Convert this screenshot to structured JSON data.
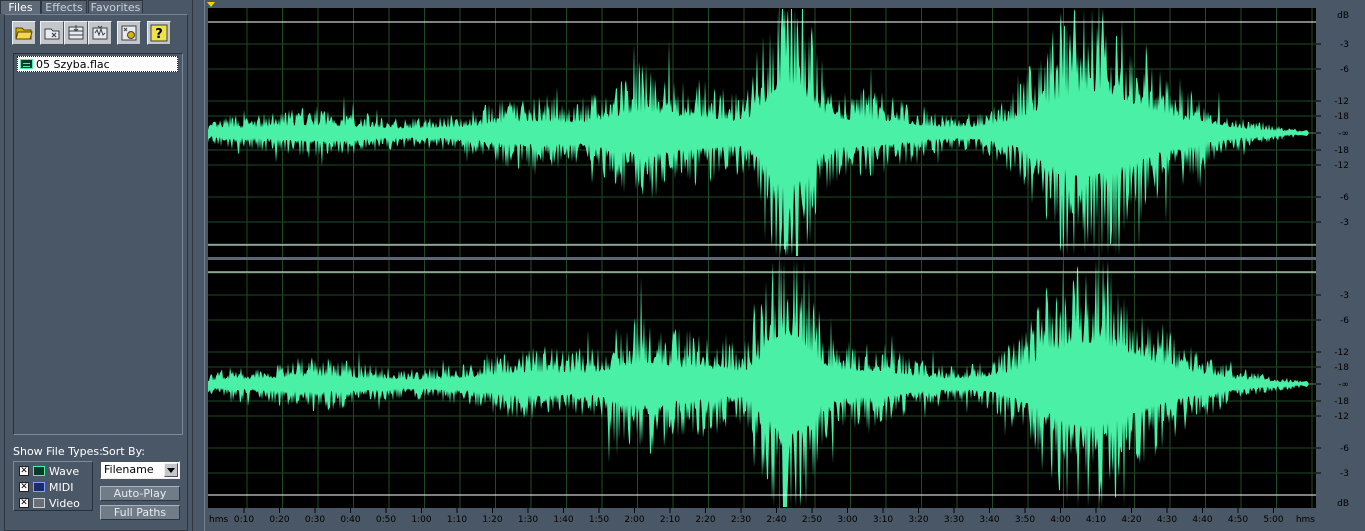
{
  "colors": {
    "panel_bg": "#4a5766",
    "wave": "#4af0a5",
    "wave_bg": "#000000",
    "grid": "#1f4a24",
    "marker": "#f4d000"
  },
  "tabs": [
    {
      "label": "Files",
      "active": true
    },
    {
      "label": "Effects",
      "active": false
    },
    {
      "label": "Favorites",
      "active": false
    }
  ],
  "toolbar": {
    "buttons": [
      "open-folder-icon",
      "close-file-icon",
      "insert-into-multitrack-icon",
      "edit-file-icon",
      "settings-icon",
      "help-icon"
    ]
  },
  "files": [
    {
      "name": "05 Szyba.flac",
      "selected": true,
      "icon": "waveform-file-icon"
    }
  ],
  "show_types": {
    "label": "Show File Types:",
    "items": [
      {
        "label": "Wave",
        "checked": true,
        "icon": "wave-type-icon"
      },
      {
        "label": "MIDI",
        "checked": true,
        "icon": "midi-type-icon"
      },
      {
        "label": "Video",
        "checked": true,
        "icon": "video-type-icon"
      }
    ]
  },
  "sort": {
    "label": "Sort By:",
    "value": "Filename",
    "autoplay_label": "Auto-Play",
    "fullpaths_label": "Full Paths"
  },
  "db_scale": {
    "top_label": "dB",
    "bottom_label": "dB",
    "levels": [
      "-3",
      "-6",
      "-12",
      "-18",
      "-∞",
      "-18",
      "-12",
      "-6",
      "-3"
    ]
  },
  "time_ruler": {
    "unit_label": "hms",
    "ticks": [
      "0:10",
      "0:20",
      "0:30",
      "0:40",
      "0:50",
      "1:00",
      "1:10",
      "1:20",
      "1:30",
      "1:40",
      "1:50",
      "2:00",
      "2:10",
      "2:20",
      "2:30",
      "2:40",
      "2:50",
      "3:00",
      "3:10",
      "3:20",
      "3:30",
      "3:40",
      "3:50",
      "4:00",
      "4:10",
      "4:20",
      "4:30",
      "4:40",
      "4:50",
      "5:00"
    ],
    "end_label": "hms"
  }
}
